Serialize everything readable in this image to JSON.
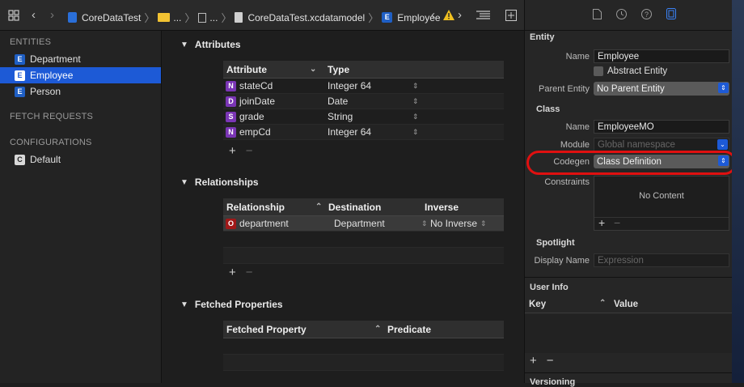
{
  "toolbar": {
    "project": "CoreDataTest",
    "folder_ellipsis": "...",
    "group_ellipsis": "...",
    "file": "CoreDataTest.xcdatamodel",
    "entity": "Employee",
    "entity_badge": "E"
  },
  "sidebar": {
    "entities_header": "ENTITIES",
    "entities": [
      {
        "badge": "E",
        "label": "Department"
      },
      {
        "badge": "E",
        "label": "Employee"
      },
      {
        "badge": "E",
        "label": "Person"
      }
    ],
    "fetch_header": "FETCH REQUESTS",
    "config_header": "CONFIGURATIONS",
    "configs": [
      {
        "badge": "C",
        "label": "Default"
      }
    ]
  },
  "attributes": {
    "title": "Attributes",
    "col_attribute": "Attribute",
    "col_type": "Type",
    "rows": [
      {
        "badge": "N",
        "name": "stateCd",
        "type": "Integer 64"
      },
      {
        "badge": "D",
        "name": "joinDate",
        "type": "Date"
      },
      {
        "badge": "S",
        "name": "grade",
        "type": "String"
      },
      {
        "badge": "N",
        "name": "empCd",
        "type": "Integer 64"
      }
    ]
  },
  "relationships": {
    "title": "Relationships",
    "col_relationship": "Relationship",
    "col_destination": "Destination",
    "col_inverse": "Inverse",
    "rows": [
      {
        "badge": "O",
        "name": "department",
        "destination": "Department",
        "inverse": "No Inverse"
      }
    ]
  },
  "fetched": {
    "title": "Fetched Properties",
    "col_property": "Fetched Property",
    "col_predicate": "Predicate"
  },
  "inspector": {
    "entity_header": "Entity",
    "name_label": "Name",
    "name_value": "Employee",
    "abstract_label": "Abstract Entity",
    "parent_label": "Parent Entity",
    "parent_value": "No Parent Entity",
    "class_header": "Class",
    "class_name_label": "Name",
    "class_name_value": "EmployeeMO",
    "module_label": "Module",
    "module_placeholder": "Global namespace",
    "codegen_label": "Codegen",
    "codegen_value": "Class Definition",
    "constraints_label": "Constraints",
    "no_content": "No Content",
    "spotlight_header": "Spotlight",
    "display_name_label": "Display Name",
    "display_name_placeholder": "Expression",
    "userinfo_header": "User Info",
    "key_label": "Key",
    "value_label": "Value",
    "versioning_header": "Versioning"
  },
  "colors": {
    "accent": "#1d5ad6",
    "highlight_ring": "#e01010"
  }
}
